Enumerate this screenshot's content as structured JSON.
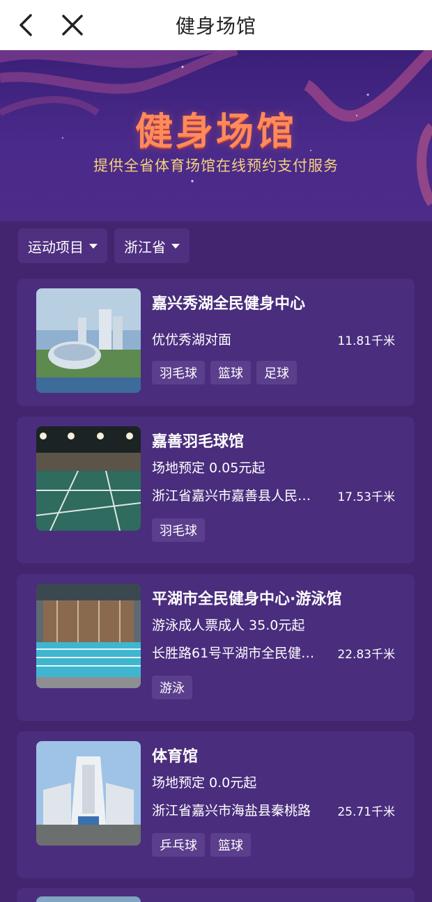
{
  "topbar": {
    "title": "健身场馆"
  },
  "banner": {
    "headline": "健身场馆",
    "subtitle": "提供全省体育场馆在线预约支付服务"
  },
  "filters": [
    {
      "label": "运动项目"
    },
    {
      "label": "浙江省"
    }
  ],
  "venues": [
    {
      "name": "嘉兴秀湖全民健身中心",
      "price": "",
      "address": "优优秀湖对面",
      "distance": "11.81千米",
      "tags": [
        "羽毛球",
        "篮球",
        "足球"
      ]
    },
    {
      "name": "嘉善羽毛球馆",
      "price": "场地预定 0.05元起",
      "address": "浙江省嘉兴市嘉善县人民…",
      "distance": "17.53千米",
      "tags": [
        "羽毛球"
      ]
    },
    {
      "name": "平湖市全民健身中心·游泳馆",
      "price": "游泳成人票成人 35.0元起",
      "address": "长胜路61号平湖市全民健…",
      "distance": "22.83千米",
      "tags": [
        "游泳"
      ]
    },
    {
      "name": "体育馆",
      "price": "场地预定 0.0元起",
      "address": "浙江省嘉兴市海盐县秦桃路",
      "distance": "25.71千米",
      "tags": [
        "乒乓球",
        "篮球"
      ]
    }
  ],
  "colors": {
    "background": "#43246e",
    "card": "#4a2d7d",
    "headline": "#ff8a5c",
    "subtitle": "#f5d27a"
  }
}
